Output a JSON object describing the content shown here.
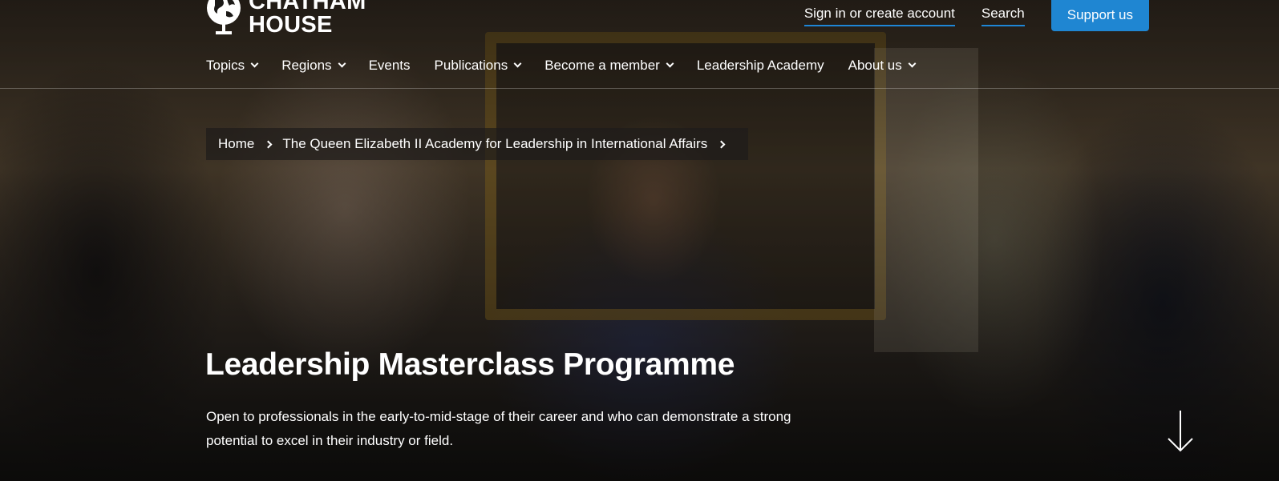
{
  "logo": {
    "line1": "CHATHAM",
    "line2": "HOUSE"
  },
  "utility": {
    "signin_label": "Sign in or create account",
    "search_label": "Search",
    "support_label": "Support us",
    "accent_color": "#1f86d2"
  },
  "nav": {
    "items": [
      {
        "label": "Topics",
        "has_dropdown": true
      },
      {
        "label": "Regions",
        "has_dropdown": true
      },
      {
        "label": "Events",
        "has_dropdown": false
      },
      {
        "label": "Publications",
        "has_dropdown": true
      },
      {
        "label": "Become a member",
        "has_dropdown": true
      },
      {
        "label": "Leadership Academy",
        "has_dropdown": false
      },
      {
        "label": "About us",
        "has_dropdown": true
      }
    ]
  },
  "breadcrumb": {
    "items": [
      {
        "label": "Home"
      },
      {
        "label": "The Queen Elizabeth II Academy for Leadership in International Affairs"
      }
    ]
  },
  "hero": {
    "title": "Leadership Masterclass Programme",
    "description": "Open to professionals in the early-to-mid-stage of their career and who can demonstrate a strong potential to excel in their industry or field.",
    "scroll_icon": "arrow-down-icon"
  }
}
